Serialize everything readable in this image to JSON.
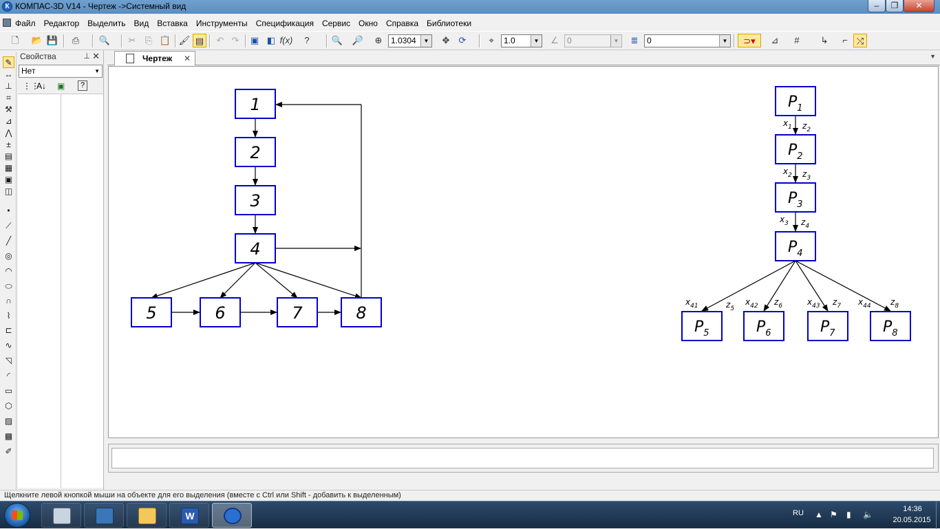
{
  "window": {
    "title": "КОМПАС-3D V14 - Чертеж ->Системный вид",
    "app_icon": "kompas-icon",
    "minimize_label": "–",
    "maximize_label": "❐",
    "close_label": "✕"
  },
  "menu": [
    "Файл",
    "Редактор",
    "Выделить",
    "Вид",
    "Вставка",
    "Инструменты",
    "Спецификация",
    "Сервис",
    "Окно",
    "Справка",
    "Библиотеки"
  ],
  "toolbar": {
    "zoom_value": "1.0304",
    "step_value": "1.0",
    "angle_value": "0",
    "layer_value": "0"
  },
  "properties_panel": {
    "title": "Свойства",
    "selection": "Нет"
  },
  "document_tab": {
    "label": "Чертеж"
  },
  "diagram_left": {
    "nodes": [
      "1",
      "2",
      "3",
      "4",
      "5",
      "6",
      "7",
      "8"
    ]
  },
  "diagram_right": {
    "nodes": [
      "P1",
      "P2",
      "P3",
      "P4",
      "P5",
      "P6",
      "P7",
      "P8"
    ],
    "edge_labels": [
      "x1",
      "z2",
      "x2",
      "z3",
      "x3",
      "z4",
      "x41",
      "z5",
      "x42",
      "z6",
      "x43",
      "z7",
      "x44",
      "z8"
    ]
  },
  "status_text": "Щелкните левой кнопкой мыши на объекте для его выделения (вместе с Ctrl или Shift - добавить к выделенным)",
  "taskbar": {
    "apps": [
      "calculator",
      "remote-desktop",
      "file-explorer",
      "word",
      "kompas"
    ],
    "active_app": "kompas",
    "language": "RU",
    "time": "14:36",
    "date": "20.05.2015"
  },
  "colors": {
    "box_stroke": "#0000c8",
    "line_stroke": "#000000",
    "title_bar": "#5b8ec2"
  }
}
